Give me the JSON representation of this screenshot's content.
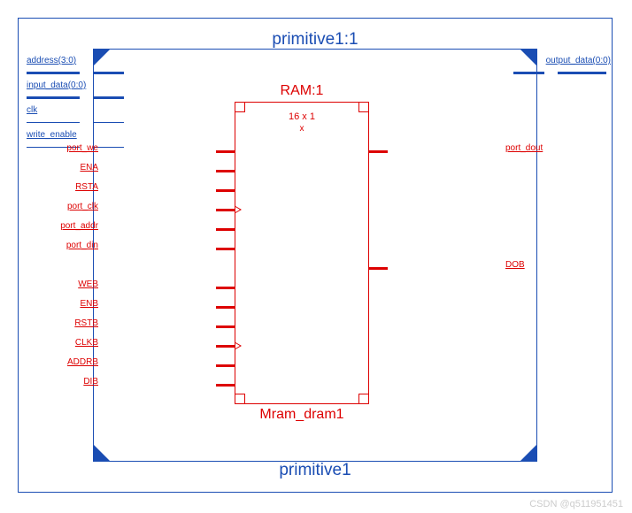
{
  "primitive": {
    "title_top": "primitive1:1",
    "title_bottom": "primitive1",
    "inputs": [
      {
        "label": "address(3:0)",
        "bus": true
      },
      {
        "label": "input_data(0:0)",
        "bus": true
      },
      {
        "label": "clk",
        "bus": false
      },
      {
        "label": "write_enable",
        "bus": false
      }
    ],
    "outputs": [
      {
        "label": "output_data(0:0)",
        "bus": true
      }
    ]
  },
  "ram": {
    "title": "RAM:1",
    "name": "Mram_dram1",
    "dimensions": "16 x 1",
    "x_label": "x",
    "ports_left": [
      {
        "label": "port_we",
        "clk": false
      },
      {
        "label": "ENA",
        "clk": false
      },
      {
        "label": "RSTA",
        "clk": false
      },
      {
        "label": "port_clk",
        "clk": true
      },
      {
        "label": "port_addr",
        "clk": false
      },
      {
        "label": "port_din",
        "clk": false
      },
      {
        "label": "WEB",
        "clk": false
      },
      {
        "label": "ENB",
        "clk": false
      },
      {
        "label": "RSTB",
        "clk": false
      },
      {
        "label": "CLKB",
        "clk": true
      },
      {
        "label": "ADDRB",
        "clk": false
      },
      {
        "label": "DIB",
        "clk": false
      }
    ],
    "ports_right": [
      {
        "label": "port_dout",
        "group": 0
      },
      {
        "label": "DOB",
        "group": 1
      }
    ]
  },
  "watermark": "CSDN @q511951451"
}
